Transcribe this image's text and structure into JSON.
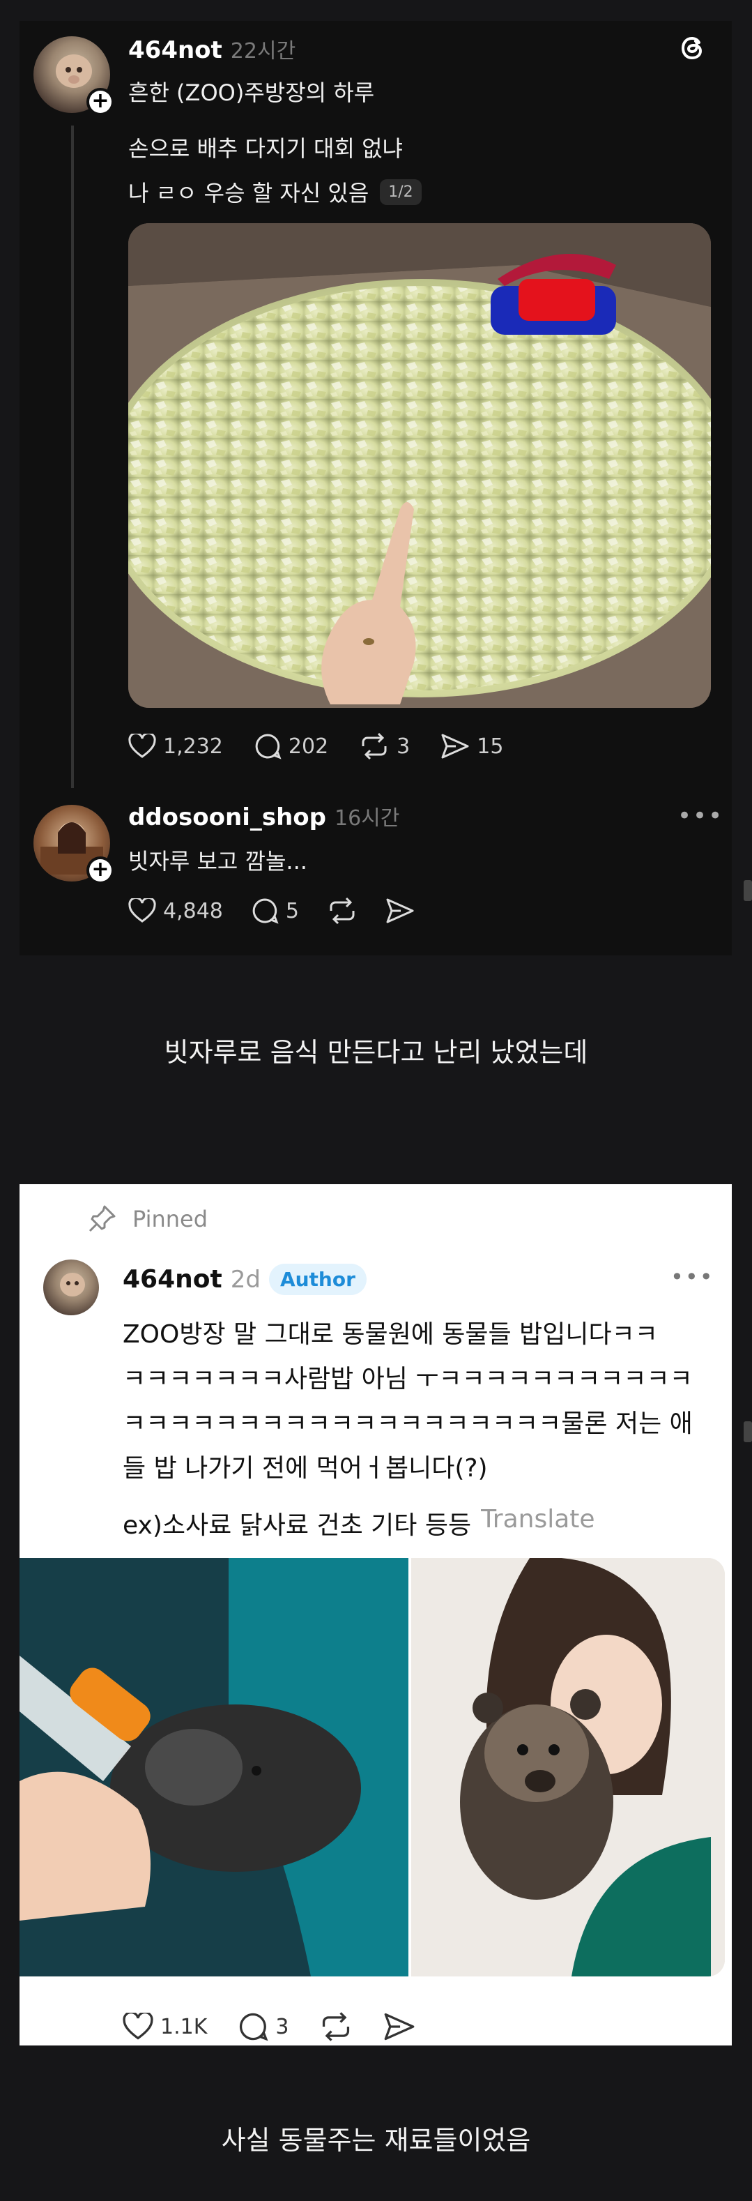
{
  "post1": {
    "username": "464not",
    "time": "22시간",
    "caption": "흔한 (ZOO)주방장의 하루",
    "line1": "손으로 배추 다지기 대회 없냐",
    "line2": "나 ㄹㅇ 우승 할 자신 있음",
    "page_indicator": "1/2",
    "likes": "1,232",
    "comments": "202",
    "reposts": "3",
    "shares": "15"
  },
  "reply": {
    "username": "ddosooni_shop",
    "time": "16시간",
    "text": "빗자루 보고 깜놀...",
    "likes": "4,848",
    "comments": "5"
  },
  "caption_middle": "빗자루로 음식 만든다고 난리 났었는데",
  "post2": {
    "pinned_label": "Pinned",
    "username": "464not",
    "time": "2d",
    "author_badge": "Author",
    "text_lines": [
      "ZOO방장 말 그대로 동물원에 동물들 밥입니다ㅋㅋ",
      "ㅋㅋㅋㅋㅋㅋㅋ사람밥 아님 ㅜㅋㅋㅋㅋㅋㅋㅋㅋㅋㅋㅋ",
      "ㅋㅋㅋㅋㅋㅋㅋㅋㅋㅋㅋㅋㅋㅋㅋㅋㅋㅋㅋ물론 저는 애",
      "들 밥 나가기 전에 먹어ㅓ봅니다(?)"
    ],
    "ex_line": "ex)소사료 닭사료 건초 기타 등등",
    "translate_label": "Translate",
    "likes": "1.1K",
    "comments": "3"
  },
  "caption_bottom": "사실 동물주는 재료들이었음",
  "colors": {
    "background": "#161618",
    "card_dark": "#101010",
    "author_badge_bg": "#e3f3fd",
    "author_badge_text": "#1d8cd8",
    "muted_text": "#7a7a7a"
  }
}
